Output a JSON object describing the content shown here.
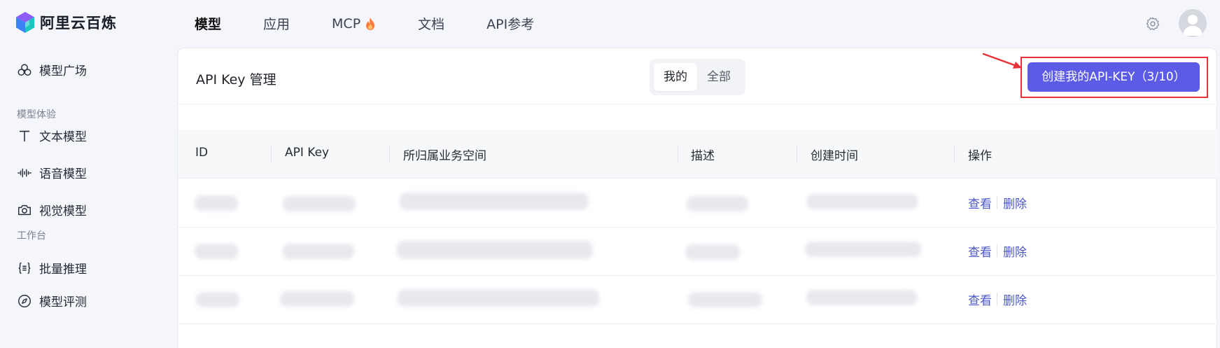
{
  "brand": {
    "name": "阿里云百炼"
  },
  "nav": {
    "items": [
      {
        "label": "模型",
        "active": true
      },
      {
        "label": "应用",
        "active": false
      },
      {
        "label": "MCP",
        "active": false,
        "icon": "fire-icon"
      },
      {
        "label": "文档",
        "active": false
      },
      {
        "label": "API参考",
        "active": false
      }
    ]
  },
  "sidebar": {
    "model_square": "模型广场",
    "group_experience": "模型体验",
    "text_model": "文本模型",
    "voice_model": "语音模型",
    "vision_model": "视觉模型",
    "group_workbench": "工作台",
    "batch_inference": "批量推理",
    "model_eval": "模型评测"
  },
  "panel": {
    "title": "API Key 管理",
    "segment": {
      "mine": "我的",
      "all": "全部"
    },
    "create_button": "创建我的API-KEY（3/10）"
  },
  "table": {
    "columns": [
      "ID",
      "API Key",
      "所归属业务空间",
      "描述",
      "创建时间",
      "操作"
    ],
    "rows": [
      {
        "view": "查看",
        "delete": "删除"
      },
      {
        "view": "查看",
        "delete": "删除"
      },
      {
        "view": "查看",
        "delete": "删除"
      }
    ]
  },
  "colors": {
    "accent": "#5b5be6",
    "highlight": "#e6333a",
    "link": "#4b57c9"
  }
}
